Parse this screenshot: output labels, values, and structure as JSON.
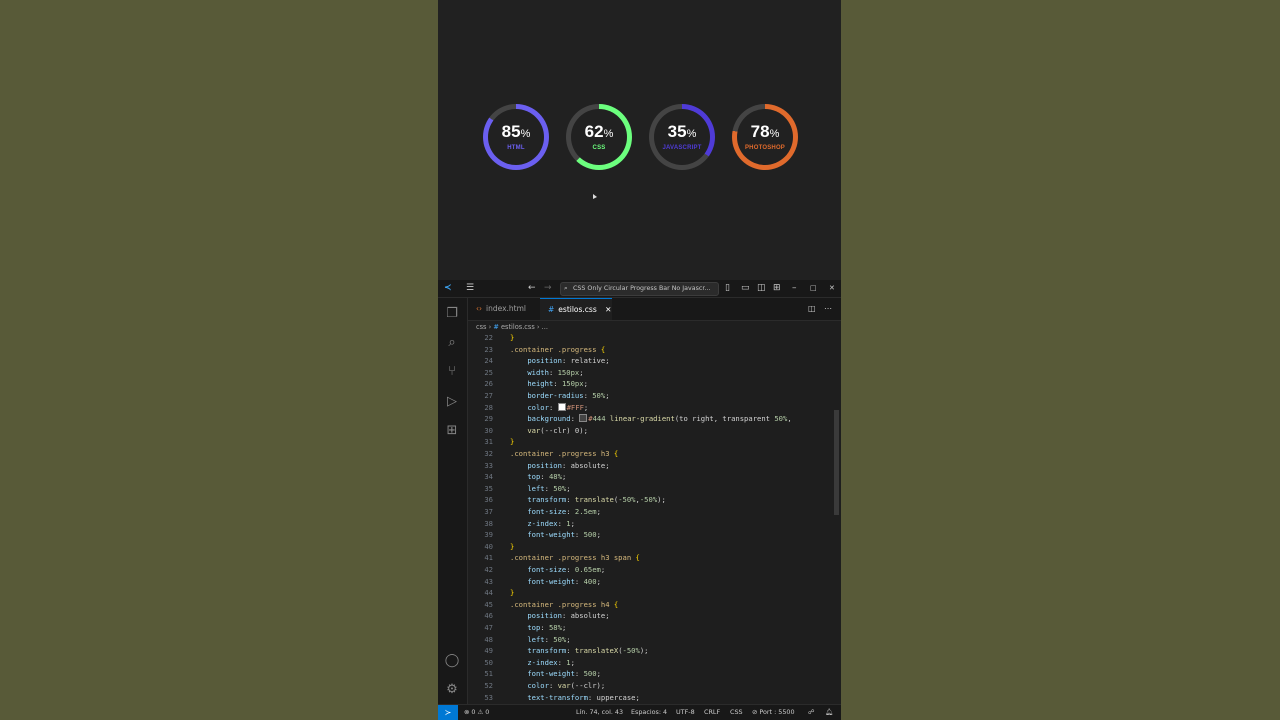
{
  "preview": {
    "progress": [
      {
        "value": 85,
        "label": "HTML",
        "color": "#6b5ff0"
      },
      {
        "value": 62,
        "label": "CSS",
        "color": "#6cff7e"
      },
      {
        "value": 35,
        "label": "JAVASCRIPT",
        "color": "#4f3bd7"
      },
      {
        "value": 78,
        "label": "PHOTOSHOP",
        "color": "#e06a2c"
      }
    ],
    "percent_sign": "%"
  },
  "titlebar": {
    "command_center": "CSS Only Circular Progress Bar No Javascr..."
  },
  "tabs": [
    {
      "label": "index.html",
      "icon": "html-file-icon",
      "active": false
    },
    {
      "label": "estilos.css",
      "icon": "css-file-icon",
      "active": true,
      "close": "✕"
    }
  ],
  "breadcrumb": {
    "folder": "css",
    "file": "estilos.css",
    "more": "..."
  },
  "editor": {
    "lines": [
      {
        "n": "22",
        "code": "}"
      },
      {
        "n": "23",
        "code": ".container .progress {"
      },
      {
        "n": "24",
        "code": "    position: relative;"
      },
      {
        "n": "25",
        "code": "    width: 150px;"
      },
      {
        "n": "26",
        "code": "    height: 150px;"
      },
      {
        "n": "27",
        "code": "    border-radius: 50%;"
      },
      {
        "n": "28",
        "code": "    color: #FFF;"
      },
      {
        "n": "29",
        "code": "    background: #444 linear-gradient(to right, transparent 50%,"
      },
      {
        "n": "30",
        "code": "    var(--clr) 0);"
      },
      {
        "n": "31",
        "code": "}"
      },
      {
        "n": "32",
        "code": ".container .progress h3 {"
      },
      {
        "n": "33",
        "code": "    position: absolute;"
      },
      {
        "n": "34",
        "code": "    top: 48%;"
      },
      {
        "n": "35",
        "code": "    left: 50%;"
      },
      {
        "n": "36",
        "code": "    transform: translate(-50%,-50%);"
      },
      {
        "n": "37",
        "code": "    font-size: 2.5em;"
      },
      {
        "n": "38",
        "code": "    z-index: 1;"
      },
      {
        "n": "39",
        "code": "    font-weight: 500;"
      },
      {
        "n": "40",
        "code": "}"
      },
      {
        "n": "41",
        "code": ".container .progress h3 span {"
      },
      {
        "n": "42",
        "code": "    font-size: 0.65em;"
      },
      {
        "n": "43",
        "code": "    font-weight: 400;"
      },
      {
        "n": "44",
        "code": "}"
      },
      {
        "n": "45",
        "code": ".container .progress h4 {"
      },
      {
        "n": "46",
        "code": "    position: absolute;"
      },
      {
        "n": "47",
        "code": "    top: 58%;"
      },
      {
        "n": "48",
        "code": "    left: 50%;"
      },
      {
        "n": "49",
        "code": "    transform: translateX(-50%);"
      },
      {
        "n": "50",
        "code": "    z-index: 1;"
      },
      {
        "n": "51",
        "code": "    font-weight: 500;"
      },
      {
        "n": "52",
        "code": "    color: var(--clr);"
      },
      {
        "n": "53",
        "code": "    text-transform: uppercase;"
      }
    ]
  },
  "statusbar": {
    "problems": "⊗ 0 ⚠ 0",
    "position": "Lín. 74, col. 43",
    "spaces": "Espacios: 4",
    "encoding": "UTF-8",
    "eol": "CRLF",
    "language": "CSS",
    "port": "⊘ Port : 5500"
  }
}
